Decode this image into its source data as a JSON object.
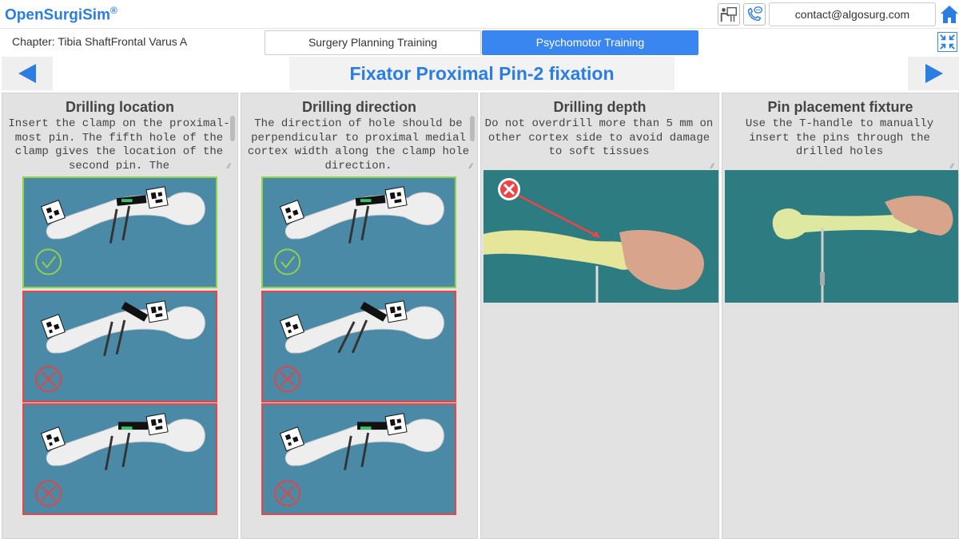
{
  "app": {
    "logo_text": "OpenSurgiSim",
    "logo_mark": "®"
  },
  "header": {
    "contact_email": "contact@algosurg.com",
    "icons": [
      "teacher-icon",
      "phone-chat-icon",
      "home-icon"
    ]
  },
  "subheader": {
    "chapter": "Chapter: Tibia ShaftFrontal Varus A",
    "tabs": [
      {
        "label": "Surgery Planning Training",
        "active": false
      },
      {
        "label": "Psychomotor Training",
        "active": true
      }
    ],
    "shrink_icon": "collapse-icon"
  },
  "step": {
    "title": "Fixator Proximal Pin-2 fixation",
    "prev_icon": "arrow-left-icon",
    "next_icon": "arrow-right-icon"
  },
  "panels": [
    {
      "title": "Drilling location",
      "text": "Insert the clamp on the proximal-most pin. The fifth hole of the clamp gives the location of the second pin. The",
      "cards": [
        "correct",
        "incorrect",
        "incorrect"
      ]
    },
    {
      "title": "Drilling direction",
      "text": "The direction of hole should be perpendicular to proximal medial cortex width along the clamp hole direction.",
      "cards": [
        "correct",
        "incorrect",
        "incorrect"
      ]
    },
    {
      "title": "Drilling depth",
      "text": "Do not overdrill more than 5 mm on other cortex side to avoid damage to soft tissues"
    },
    {
      "title": "Pin placement fixture",
      "text": "Use the T-handle to manually insert the pins through the drilled holes"
    }
  ],
  "colors": {
    "accent": "#2a7de1",
    "tab_active": "#3a86f0",
    "correct": "#8fd34a",
    "incorrect": "#e44444",
    "card_bg": "#4a8aa6"
  }
}
